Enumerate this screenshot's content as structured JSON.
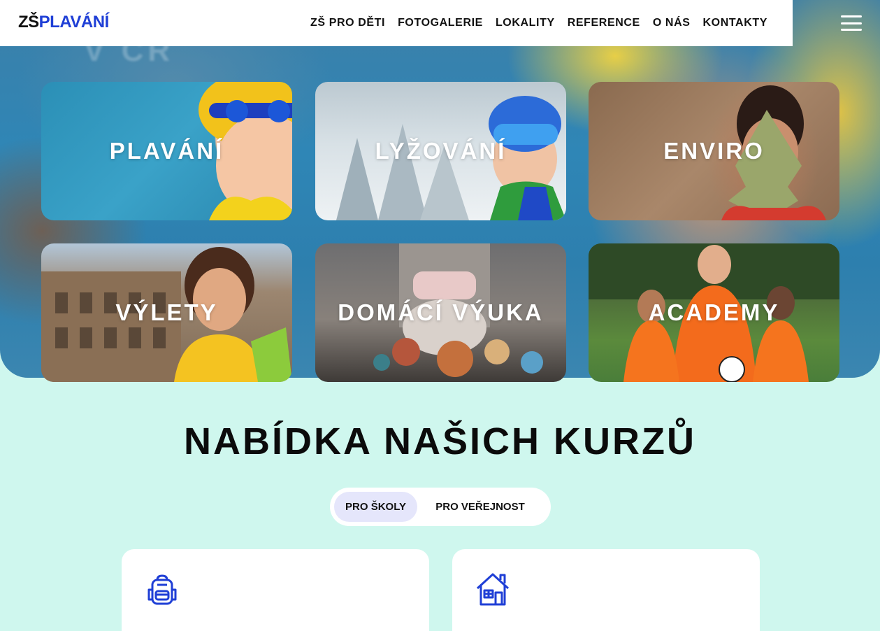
{
  "header": {
    "logo": {
      "part1": "ZŠ",
      "part2": "PLAVÁNÍ"
    },
    "nav": [
      {
        "label": "ZŠ PRO DĚTI"
      },
      {
        "label": "FOTOGALERIE"
      },
      {
        "label": "LOKALITY"
      },
      {
        "label": "REFERENCE"
      },
      {
        "label": "O NÁS"
      },
      {
        "label": "KONTAKTY"
      }
    ],
    "menu_icon": "hamburger-menu-icon"
  },
  "hero": {
    "faint_text": "V ČR"
  },
  "tiles": [
    {
      "label": "PLAVÁNÍ"
    },
    {
      "label": "LYŽOVÁNÍ"
    },
    {
      "label": "ENVIRO"
    },
    {
      "label": "VÝLETY"
    },
    {
      "label": "DOMÁCÍ VÝUKA"
    },
    {
      "label": "ACADEMY"
    }
  ],
  "offer": {
    "title": "NABÍDKA NAŠICH KURZŮ",
    "tabs": [
      {
        "label": "PRO ŠKOLY",
        "active": true
      },
      {
        "label": "PRO VEŘEJNOST",
        "active": false
      }
    ],
    "cards": [
      {
        "icon": "backpack-icon"
      },
      {
        "icon": "house-icon"
      }
    ]
  },
  "colors": {
    "brand_blue": "#1f3fd6",
    "section_background": "#cff7ee",
    "tab_active": "#e5e6fb"
  }
}
